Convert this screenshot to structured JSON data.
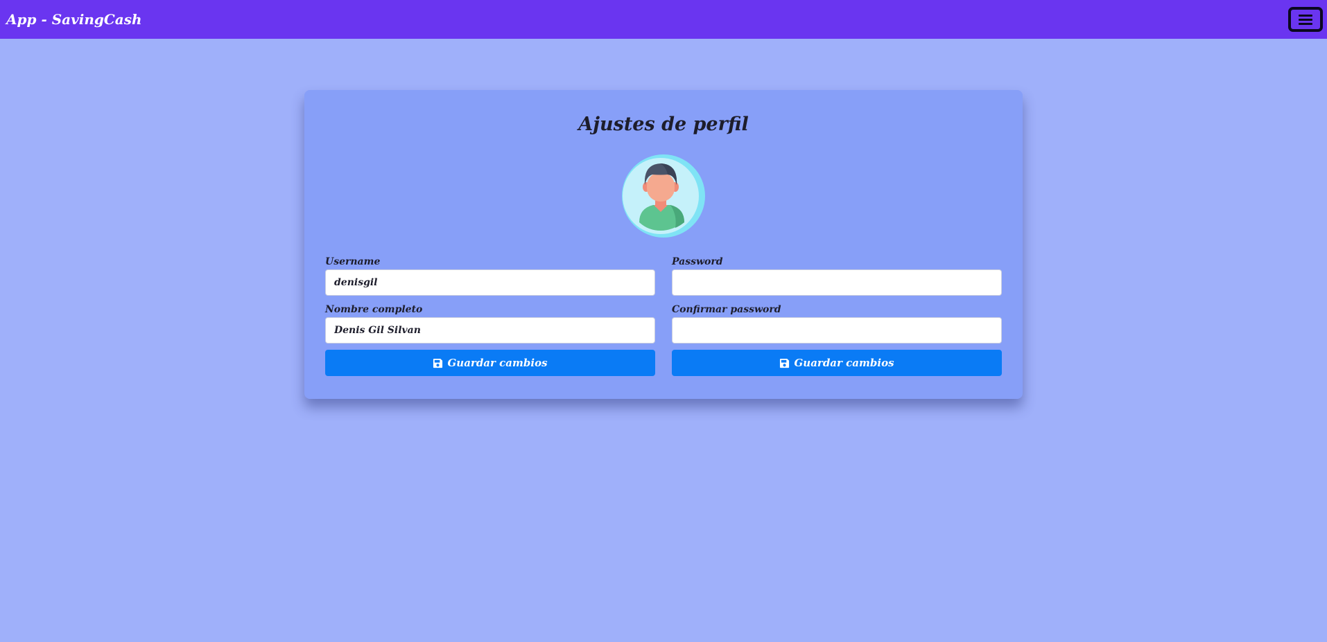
{
  "navbar": {
    "brand": "App - SavingCash",
    "menu_icon": "hamburger-icon"
  },
  "profile": {
    "title": "Ajustes de perfil",
    "avatar_icon": "user-avatar-icon"
  },
  "form": {
    "username": {
      "label": "Username",
      "value": "denisgil"
    },
    "full_name": {
      "label": "Nombre completo",
      "value": "Denis Gil Silvan"
    },
    "password": {
      "label": "Password",
      "value": ""
    },
    "confirm_password": {
      "label": "Confirmar password",
      "value": ""
    },
    "save_left": {
      "label": "Guardar cambios",
      "icon": "save-icon"
    },
    "save_right": {
      "label": "Guardar cambios",
      "icon": "save-icon"
    }
  },
  "colors": {
    "navbar": "#6a35f0",
    "background": "#9fb0fa",
    "card": "#879ff8",
    "primary_button": "#0a7bf5"
  }
}
